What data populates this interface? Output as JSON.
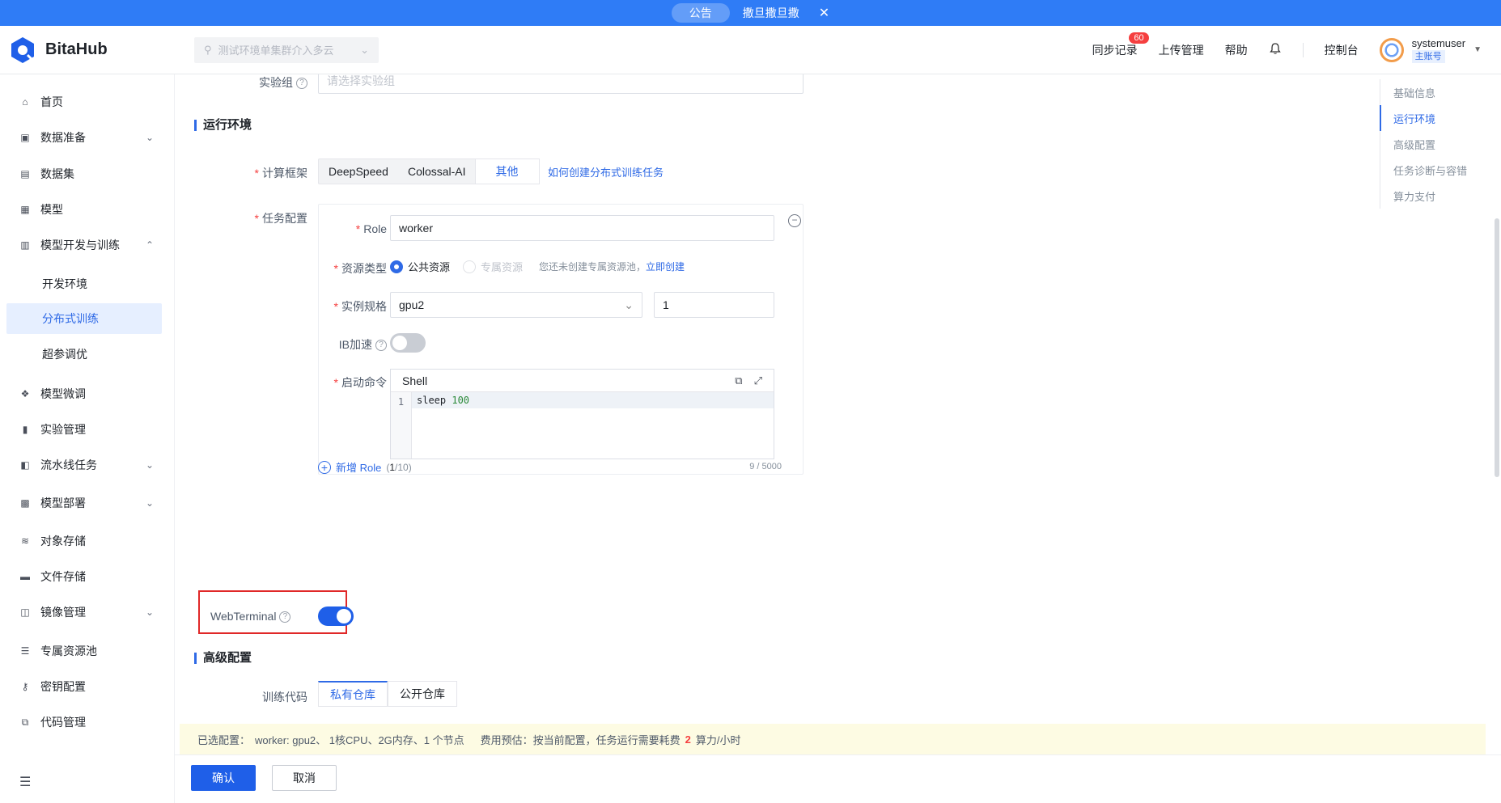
{
  "announcement": {
    "label": "公告",
    "text": "撒旦撒旦撒"
  },
  "header": {
    "brand": "BitaHub",
    "env_placeholder": "测试环境单集群介入多云",
    "sync_label": "同步记录",
    "sync_count": "60",
    "upload_label": "上传管理",
    "help_label": "帮助",
    "console_label": "控制台",
    "username": "systemuser",
    "user_tag": "主账号"
  },
  "sidebar": {
    "items": [
      {
        "label": "首页",
        "icon": "home-icon"
      },
      {
        "label": "数据准备",
        "icon": "terminal-icon",
        "chevron": "down"
      },
      {
        "label": "数据集",
        "icon": "dataset-icon"
      },
      {
        "label": "模型",
        "icon": "grid-icon"
      },
      {
        "label": "模型开发与训练",
        "icon": "book-icon",
        "chevron": "up"
      },
      {
        "label": "开发环境",
        "sub": true
      },
      {
        "label": "分布式训练",
        "sub": true,
        "active": true
      },
      {
        "label": "超参调优",
        "sub": true
      },
      {
        "label": "模型微调",
        "icon": "nodes-icon"
      },
      {
        "label": "实验管理",
        "icon": "bar-chart-icon"
      },
      {
        "label": "流水线任务",
        "icon": "pipeline-icon",
        "chevron": "down"
      },
      {
        "label": "模型部署",
        "icon": "deploy-icon",
        "chevron": "down"
      },
      {
        "label": "对象存储",
        "icon": "layers-icon"
      },
      {
        "label": "文件存储",
        "icon": "folder-icon"
      },
      {
        "label": "镜像管理",
        "icon": "image-icon",
        "chevron": "down"
      },
      {
        "label": "专属资源池",
        "icon": "server-icon"
      },
      {
        "label": "密钥配置",
        "icon": "key-icon"
      },
      {
        "label": "代码管理",
        "icon": "code-icon"
      }
    ]
  },
  "form": {
    "experiment_group_label": "实验组",
    "experiment_group_placeholder": "请选择实验组",
    "runtime_section": "运行环境",
    "framework_label": "计算框架",
    "frameworks": [
      "DeepSpeed",
      "Colossal-AI",
      "其他"
    ],
    "framework_selected": "其他",
    "framework_help_link": "如何创建分布式训练任务",
    "task_config_label": "任务配置",
    "role_label": "Role",
    "role_value": "worker",
    "resource_type_label": "资源类型",
    "resource_public": "公共资源",
    "resource_dedicated": "专属资源",
    "resource_hint": "您还未创建专属资源池，",
    "resource_create_link": "立即创建",
    "instance_spec_label": "实例规格",
    "instance_spec_value": "gpu2",
    "instance_count": "1",
    "ib_label": "IB加速",
    "ib_enabled": false,
    "cmd_label": "启动命令",
    "cmd_lang": "Shell",
    "cmd_line_no": "1",
    "cmd_keyword": "sleep",
    "cmd_arg": "100",
    "cmd_counter": "9 / 5000",
    "add_role_label": "新增 Role",
    "add_role_count_open": "(",
    "add_role_count_current": "1",
    "add_role_count_total": "/10)",
    "webterminal_label": "WebTerminal",
    "webterminal_enabled": true,
    "advanced_section": "高级配置",
    "training_code_label": "训练代码",
    "code_tabs": [
      "私有仓库",
      "公开仓库"
    ]
  },
  "anchors": [
    "基础信息",
    "运行环境",
    "高级配置",
    "任务诊断与容错",
    "算力支付"
  ],
  "anchor_active": "运行环境",
  "summary": {
    "selected_label": "已选配置：",
    "selected_value": "worker: gpu2、 1核CPU、2G内存、1 个节点",
    "cost_label": "费用预估：按当前配置，任务运行需要耗费",
    "cost_value": "2",
    "cost_unit": "算力/小时"
  },
  "actions": {
    "confirm": "确认",
    "cancel": "取消"
  },
  "colors": {
    "primary": "#1f5fe8",
    "announce_bg": "#2f7cf6",
    "danger": "#f53f3f",
    "summary_bg": "#fdfbe3"
  }
}
